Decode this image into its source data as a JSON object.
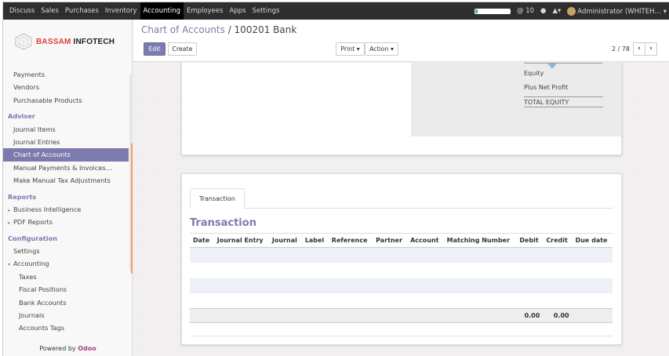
{
  "topbar": {
    "menu": [
      {
        "label": "Discuss",
        "active": false
      },
      {
        "label": "Sales",
        "active": false
      },
      {
        "label": "Purchases",
        "active": false
      },
      {
        "label": "Inventory",
        "active": false
      },
      {
        "label": "Accounting",
        "active": true
      },
      {
        "label": "Employees",
        "active": false
      },
      {
        "label": "Apps",
        "active": false
      },
      {
        "label": "Settings",
        "active": false
      }
    ],
    "messages": "@ 10",
    "user": "Administrator (WHITEH…",
    "colors": {
      "bar": "#2e2e2e",
      "active": "#000000"
    }
  },
  "logo": {
    "brand_a": "BASSAM",
    "brand_b": " INFOTECH"
  },
  "sidebar": {
    "items": [
      {
        "type": "item",
        "label": "Payments"
      },
      {
        "type": "item",
        "label": "Vendors"
      },
      {
        "type": "item",
        "label": "Purchasable Products"
      },
      {
        "type": "header",
        "label": "Adviser"
      },
      {
        "type": "item",
        "label": "Journal Items"
      },
      {
        "type": "item",
        "label": "Journal Entries"
      },
      {
        "type": "item",
        "label": "Chart of Accounts",
        "active": true
      },
      {
        "type": "item",
        "label": "Manual Payments & Invoices…"
      },
      {
        "type": "item",
        "label": "Make Manual Tax Adjustments"
      },
      {
        "type": "header",
        "label": "Reports"
      },
      {
        "type": "expand",
        "label": "Business Intelligence",
        "caret": "▸"
      },
      {
        "type": "expand",
        "label": "PDF Reports",
        "caret": "▸"
      },
      {
        "type": "header",
        "label": "Configuration"
      },
      {
        "type": "item",
        "label": "Settings"
      },
      {
        "type": "expand",
        "label": "Accounting",
        "caret": "▾"
      },
      {
        "type": "sub",
        "label": "Taxes"
      },
      {
        "type": "sub",
        "label": "Fiscal Positions"
      },
      {
        "type": "sub",
        "label": "Bank Accounts"
      },
      {
        "type": "sub",
        "label": "Journals"
      },
      {
        "type": "sub",
        "label": "Accounts Tags"
      }
    ],
    "powered_prefix": "Powered by ",
    "powered_brand": "Odoo",
    "accent": "#7c7bad"
  },
  "control_panel": {
    "breadcrumb_link": "Chart of Accounts",
    "breadcrumb_sep": " / ",
    "breadcrumb_current": "100201 Bank",
    "edit_label": "Edit",
    "create_label": "Create",
    "print_label": "Print ▾",
    "action_label": "Action ▾",
    "pager": "2 / 78",
    "prev_glyph": "‹",
    "next_glyph": "›"
  },
  "report": {
    "lines": [
      "Equity",
      "Plus Net Profit",
      "TOTAL EQUITY"
    ]
  },
  "transactions": {
    "tab_label": "Transaction",
    "title": "Transaction",
    "columns": [
      "Date",
      "Journal Entry",
      "Journal",
      "Label",
      "Reference",
      "Partner",
      "Account",
      "Matching Number",
      "Debit",
      "Credit",
      "Due date"
    ],
    "totals": {
      "debit": "0.00",
      "credit": "0.00"
    }
  }
}
